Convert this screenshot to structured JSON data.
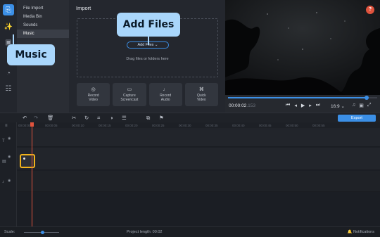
{
  "rail": {
    "icons": [
      "import-icon",
      "effects-icon",
      "filters-icon",
      "transitions-icon",
      "stickers-icon",
      "more-icon"
    ]
  },
  "submenu": {
    "items": [
      "File Import",
      "Media Bin",
      "Sounds",
      "Music"
    ],
    "selected": "Music"
  },
  "import": {
    "title": "Import",
    "add_files_label": "Add Files",
    "drag_text": "Drag files or folders here",
    "quick_buttons": [
      {
        "label": "Record\nVideo",
        "icon": "camera-icon"
      },
      {
        "label": "Capture\nScreencast",
        "icon": "monitor-icon"
      },
      {
        "label": "Record\nAudio",
        "icon": "microphone-icon"
      },
      {
        "label": "Quick\nVideo",
        "icon": "magic-icon"
      }
    ]
  },
  "tooltips": {
    "add_files": "Add Files",
    "music": "Music"
  },
  "preview": {
    "help_label": "?",
    "time_main": "00:00:02",
    "time_ms": ".153",
    "ratio": "16:9",
    "progress_fraction": 0.93
  },
  "toolbar": {
    "export_label": "Export"
  },
  "ruler": {
    "ticks": [
      "00:00:00",
      "00:00:05",
      "00:00:10",
      "00:00:15",
      "00:00:20",
      "00:00:25",
      "00:00:30",
      "00:00:35",
      "00:00:40",
      "00:00:45",
      "00:00:50",
      "00:00:55"
    ]
  },
  "status": {
    "scale_label": "Scale:",
    "project_length": "Project length:  00:02",
    "notifications": "Notifications"
  },
  "colors": {
    "accent": "#3b8fe6",
    "tooltip": "#a9d6fb",
    "clip_border": "#f1b31c",
    "playhead": "#e0533d"
  }
}
